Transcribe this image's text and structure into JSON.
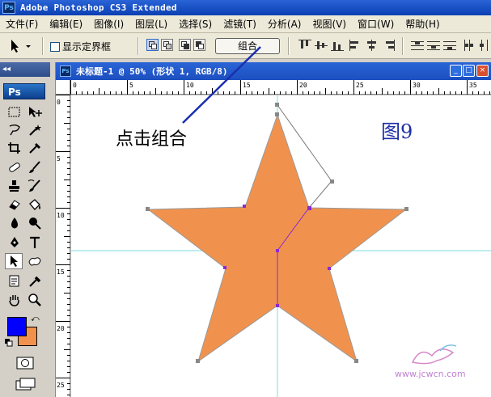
{
  "app": {
    "title": "Adobe Photoshop CS3 Extended",
    "icon_label": "Ps"
  },
  "menu": {
    "items": [
      "文件(F)",
      "编辑(E)",
      "图像(I)",
      "图层(L)",
      "选择(S)",
      "滤镜(T)",
      "分析(A)",
      "视图(V)",
      "窗口(W)",
      "帮助(H)"
    ]
  },
  "options": {
    "checkbox_label": "显示定界框",
    "checkbox_checked": false,
    "combine_button": "组合"
  },
  "toolbox": {
    "logo": "Ps",
    "collapse_glyph": "◂◂",
    "foreground_color": "#0000ff",
    "background_color": "#f0924d"
  },
  "document": {
    "icon_label": "Ps",
    "title": "未标题-1 @ 50% (形状 1, RGB/8)",
    "minimize": "_",
    "maximize": "□",
    "close": "×",
    "hruler_labels": [
      "0",
      "5",
      "10",
      "15",
      "20",
      "25",
      "30",
      "35"
    ],
    "vruler_labels": [
      "0",
      "5",
      "10",
      "15",
      "20",
      "25"
    ]
  },
  "canvas": {
    "annotation": "点击组合",
    "figure_label": "图9",
    "shape_fill": "#f0924d",
    "guide_color": "#7fdede",
    "watermark": "www.jcwcn.com"
  }
}
